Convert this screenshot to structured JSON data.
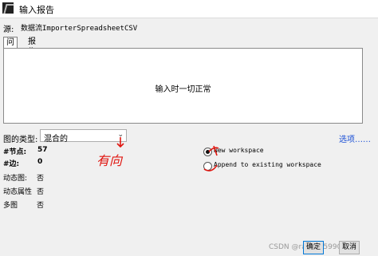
{
  "window": {
    "title": "输入报告"
  },
  "source": {
    "label": "源:",
    "value": "数据流ImporterSpreadsheetCSV"
  },
  "tabs": [
    {
      "label": "问题"
    },
    {
      "label": "报告"
    }
  ],
  "panel": {
    "message": "输入时一切正常"
  },
  "graph_type": {
    "label": "图的类型:",
    "selected": "混合的"
  },
  "options_link": "选项……",
  "stats": [
    {
      "label": "#节点:",
      "value": "57"
    },
    {
      "label": "#边:",
      "value": "0"
    }
  ],
  "properties": [
    {
      "label": "动态图:",
      "value": "否"
    },
    {
      "label": "动态属性",
      "value": "否"
    },
    {
      "label": "多图",
      "value": "否"
    }
  ],
  "radios": [
    {
      "label": "New workspace",
      "checked": true
    },
    {
      "label": "Append to existing workspace",
      "checked": false
    }
  ],
  "buttons": {
    "ok": "确定",
    "cancel": "取消"
  },
  "watermark": "CSDN @ran_5059904",
  "annotation": {
    "text": "有向",
    "color": "#e0150f"
  },
  "icons": {
    "app": "app-icon",
    "dropdown": "chevron-down-icon"
  }
}
